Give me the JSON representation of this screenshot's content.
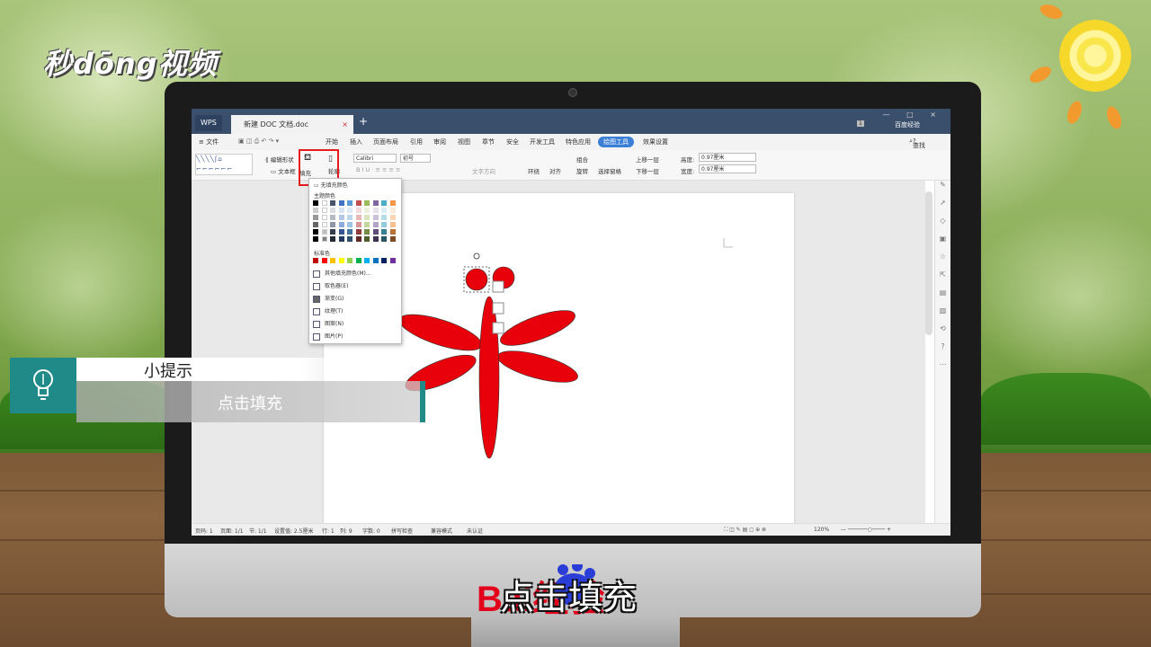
{
  "overlay": {
    "logo": "秒dōng视频",
    "tip_title": "小提示",
    "tip_text": "点击填充",
    "subtitle": "点击填充",
    "watermark": "Bai经验"
  },
  "tabbar": {
    "wps_label": "WPS",
    "doc_tab": "新建 DOC 文档.doc",
    "close": "×",
    "new_tab": "+",
    "badge": "1",
    "user": "百度经验",
    "window_controls": "— □ ×"
  },
  "menu": {
    "file": "≡ 文件",
    "items": [
      "开始",
      "插入",
      "页面布局",
      "引用",
      "审阅",
      "视图",
      "章节",
      "安全",
      "开发工具",
      "特色应用"
    ],
    "active": "绘图工具",
    "effect": "效果设置",
    "search": "查找命令、搜索模板",
    "help": "?"
  },
  "ribbon": {
    "edit_shape": "编辑形状",
    "textbox": "文本框",
    "fill": "填充",
    "outline": "轮廓",
    "font": "Calibri",
    "size": "初号",
    "text_dir": "文字方向",
    "wrap": "环绕",
    "align": "对齐",
    "group": "组合",
    "rotate": "旋转",
    "select_pane": "选择窗格",
    "bring_forward": "上移一层",
    "send_backward": "下移一层",
    "height_label": "高度:",
    "width_label": "宽度:",
    "height_val": "0.97厘米",
    "width_val": "0.97厘米"
  },
  "dropdown": {
    "no_fill": "无填充颜色",
    "theme_colors": "主题颜色",
    "standard_colors": "标准色",
    "items": [
      "其他填充颜色(M)...",
      "取色器(E)",
      "渐变(G)",
      "纹理(T)",
      "图案(N)",
      "图片(P)"
    ],
    "theme_row": [
      "#000000",
      "#ffffff",
      "#44546a",
      "#4472c4",
      "#5b9bd5",
      "#c0504d",
      "#9bbb59",
      "#8064a2",
      "#4bacc6",
      "#f79646"
    ],
    "standard_row": [
      "#c00000",
      "#ff0000",
      "#ffc000",
      "#ffff00",
      "#92d050",
      "#00b050",
      "#00b0f0",
      "#0070c0",
      "#002060",
      "#7030a0"
    ]
  },
  "statusbar": {
    "page": "页码: 1",
    "pages": "页面: 1/1",
    "section": "节: 1/1",
    "setting": "设置值: 2.5厘米",
    "row": "行: 1",
    "col": "列: 9",
    "words": "字数: 0",
    "spell": "拼写检查",
    "compat": "兼容模式",
    "unverified": "未认证",
    "zoom": "120%"
  },
  "colors": {
    "shape_red": "#e8000b",
    "accent": "#3b7fd6",
    "tip_teal": "#1f8a87",
    "highlight": "#e61b1b"
  }
}
